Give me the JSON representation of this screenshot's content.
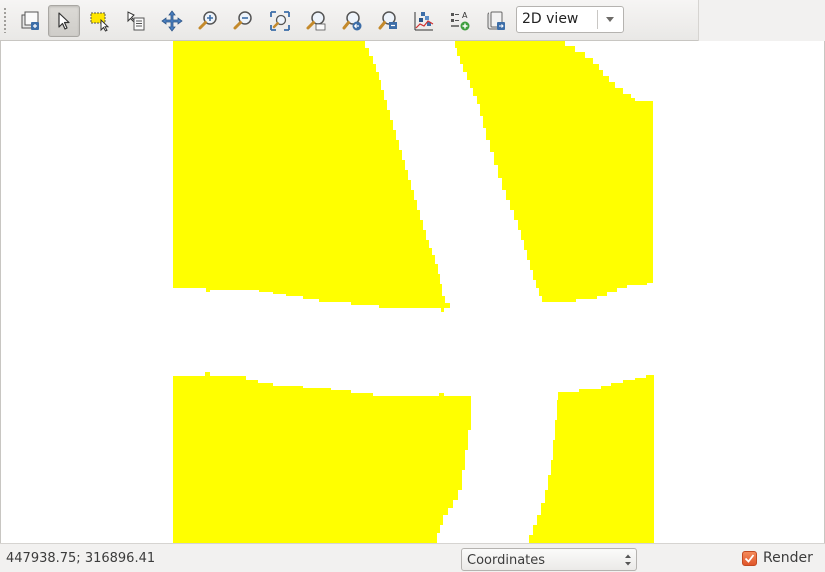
{
  "toolbar": {
    "tools": [
      {
        "id": "zoom-full",
        "icon": "zoom-full-icon",
        "active": false
      },
      {
        "id": "select",
        "icon": "select-arrow-icon",
        "active": true
      },
      {
        "id": "select-rect",
        "icon": "select-rectangle-icon",
        "active": false
      },
      {
        "id": "move-item-content",
        "icon": "move-item-content-icon",
        "active": false
      },
      {
        "id": "pan",
        "icon": "pan-icon",
        "active": false
      },
      {
        "id": "zoom-in",
        "icon": "zoom-in-icon",
        "active": false
      },
      {
        "id": "zoom-out",
        "icon": "zoom-out-icon",
        "active": false
      },
      {
        "id": "zoom-full-extent",
        "icon": "zoom-full-extent-icon",
        "active": false
      },
      {
        "id": "zoom-layer",
        "icon": "zoom-to-layer-icon",
        "active": false
      },
      {
        "id": "zoom-last",
        "icon": "zoom-last-icon",
        "active": false
      },
      {
        "id": "zoom-next",
        "icon": "zoom-next-icon",
        "active": false
      },
      {
        "id": "histogram",
        "icon": "histogram-icon",
        "active": false
      },
      {
        "id": "legend",
        "icon": "add-legend-icon",
        "active": false
      },
      {
        "id": "export",
        "icon": "export-map-icon",
        "active": false
      }
    ],
    "view_mode": {
      "value": "2D view",
      "options": [
        "2D view"
      ]
    }
  },
  "map": {
    "background": "#ffffff",
    "fill_color": "#ffff00",
    "features": [
      "top-left-polygon",
      "top-right-polygon",
      "bottom-left-polygon",
      "bottom-right-polygon"
    ]
  },
  "status": {
    "coordinates": "447938.75; 316896.41",
    "coord_mode": "Coordinates",
    "render_label": "Render",
    "render_checked": true,
    "accent": "#e8632f"
  }
}
